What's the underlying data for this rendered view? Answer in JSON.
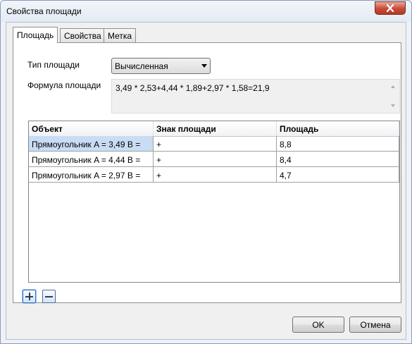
{
  "window": {
    "title": "Свойства площади"
  },
  "tabs": [
    {
      "label": "Площадь",
      "active": true
    },
    {
      "label": "Свойства",
      "active": false
    },
    {
      "label": "Метка",
      "active": false
    }
  ],
  "form": {
    "type_label": "Тип площади",
    "type_value": "Вычисленная",
    "formula_label": "Формула площади",
    "formula_value": "3,49 * 2,53+4,44 * 1,89+2,97 * 1,58=21,9"
  },
  "table": {
    "headers": [
      "Объект",
      "Знак площади",
      "Площадь"
    ],
    "rows": [
      [
        "Прямоугольник A = 3,49 B =",
        "+",
        "8,8"
      ],
      [
        "Прямоугольник A = 4,44 B =",
        "+",
        "8,4"
      ],
      [
        "Прямоугольник A = 2,97 B =",
        "+",
        "4,7"
      ]
    ]
  },
  "buttons": {
    "ok": "OK",
    "cancel": "Отмена"
  },
  "icons": {
    "close": "close-icon",
    "add": "plus-icon",
    "remove": "minus-icon",
    "dropdown": "chevron-down-icon"
  },
  "colors": {
    "selection": "#c9dcf5",
    "close_button": "#c74a36"
  }
}
